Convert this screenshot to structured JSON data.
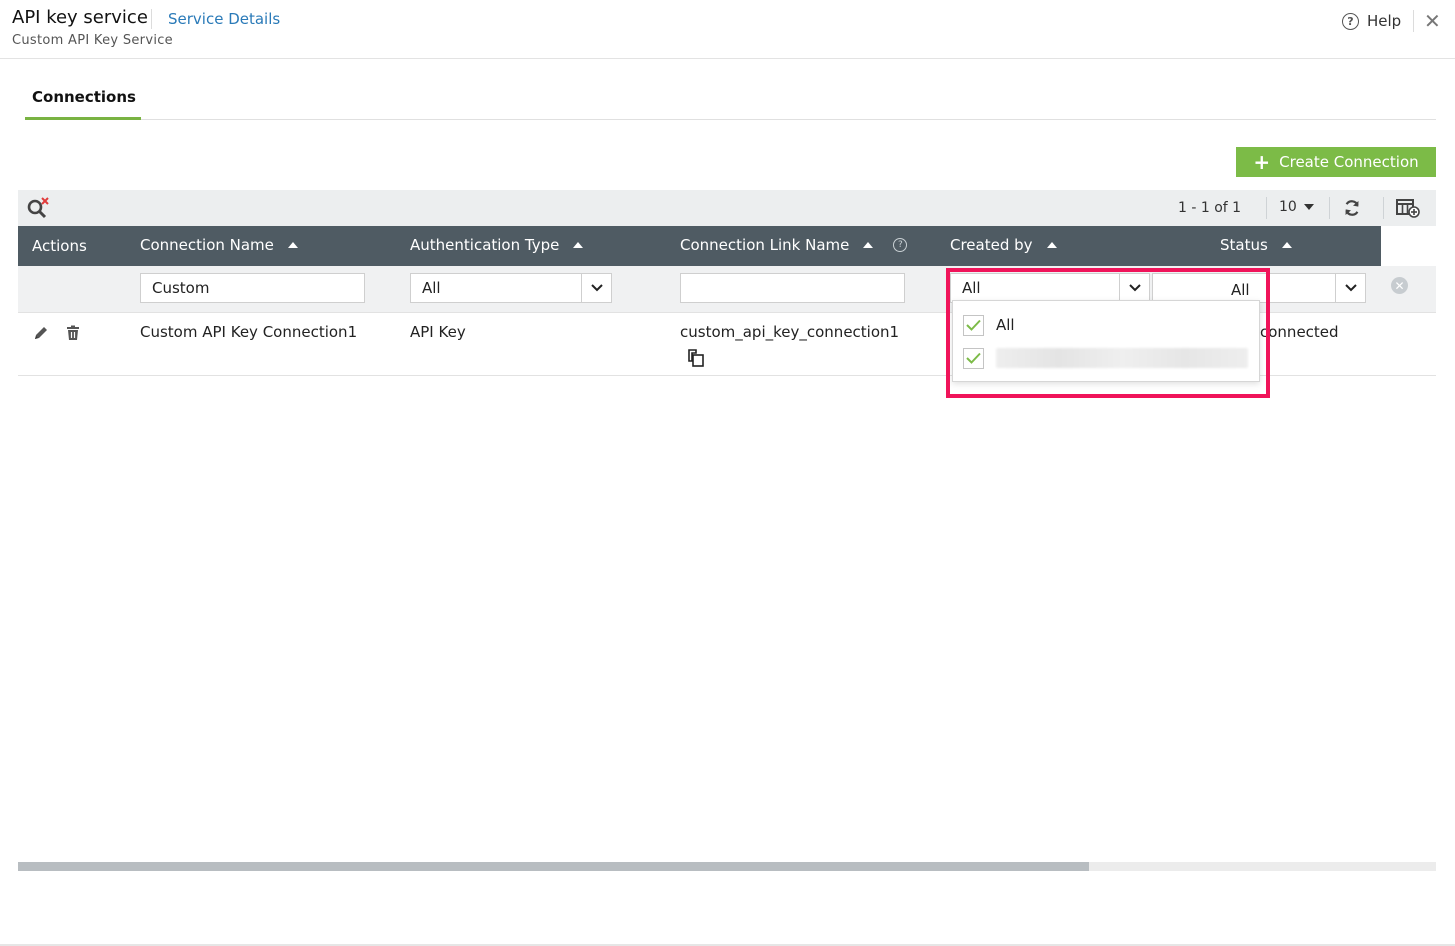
{
  "header": {
    "app_title": "API key service",
    "service_link": "Service Details",
    "subtitle": "Custom API Key Service",
    "help_label": "Help",
    "help_icon": "?",
    "close_icon": "✕"
  },
  "tabs": [
    {
      "label": "Connections",
      "active": true
    }
  ],
  "actions": {
    "create_connection": "Create Connection",
    "create_icon": "+"
  },
  "toolbar": {
    "pager_text": "1 - 1 of 1",
    "per_page": "10"
  },
  "table": {
    "columns": [
      {
        "label": "Actions"
      },
      {
        "label": "Connection Name"
      },
      {
        "label": "Authentication Type"
      },
      {
        "label": "Connection Link Name",
        "help_icon": "?"
      },
      {
        "label": "Created by"
      },
      {
        "label": "Status"
      }
    ],
    "filters": {
      "connection_name": "Custom",
      "authentication_type": "All",
      "connection_link_name": "",
      "created_by": "All",
      "status": "All"
    },
    "rows": [
      {
        "connection_name": "Custom API Key Connection1",
        "authentication_type": "API Key",
        "connection_link_name": "custom_api_key_connection1",
        "status": "connected"
      }
    ]
  },
  "created_by_dropdown": {
    "options": [
      {
        "label": "All",
        "checked": true
      },
      {
        "label": "",
        "checked": true
      }
    ]
  },
  "colors": {
    "accent_green": "#7cbb47",
    "header_bar": "#4f5b63",
    "link_blue": "#2a7ab8",
    "highlight": "#f0145a"
  }
}
